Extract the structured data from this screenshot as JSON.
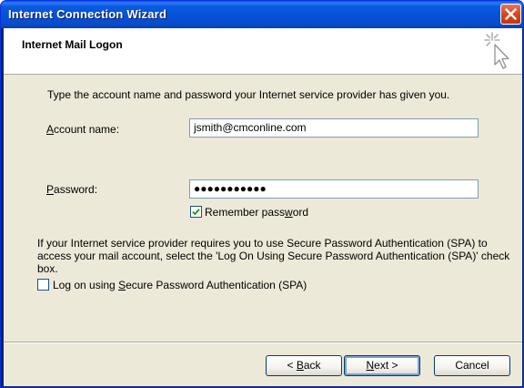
{
  "window": {
    "title": "Internet Connection Wizard"
  },
  "header": {
    "title": "Internet Mail Logon",
    "icon": "wizard-wand-icon"
  },
  "intro_text": "Type the account name and password your Internet service provider has given you.",
  "account": {
    "label_pre": "",
    "label_key": "A",
    "label_post": "ccount name:",
    "value": "jsmith@cmconline.com"
  },
  "password": {
    "label_pre": "",
    "label_key": "P",
    "label_post": "assword:",
    "masked_value": "●●●●●●●●●●●"
  },
  "remember_password": {
    "checked": true,
    "label_pre": "Remember pass",
    "label_key": "w",
    "label_post": "ord"
  },
  "spa_info": "If your Internet service provider requires you to use Secure Password Authentication (SPA) to access your mail account, select the 'Log On Using Secure Password Authentication (SPA)' check box.",
  "spa_checkbox": {
    "checked": false,
    "label_pre": "Log on using ",
    "label_key": "S",
    "label_post": "ecure Password Authentication (SPA)"
  },
  "buttons": {
    "back_pre": "< ",
    "back_key": "B",
    "back_post": "ack",
    "next_key": "N",
    "next_post": "ext >",
    "cancel": "Cancel"
  },
  "colors": {
    "titlebar": "#0550d8",
    "client_bg": "#ece9d8",
    "checkmark": "#21a121",
    "close_button": "#d9461d"
  }
}
